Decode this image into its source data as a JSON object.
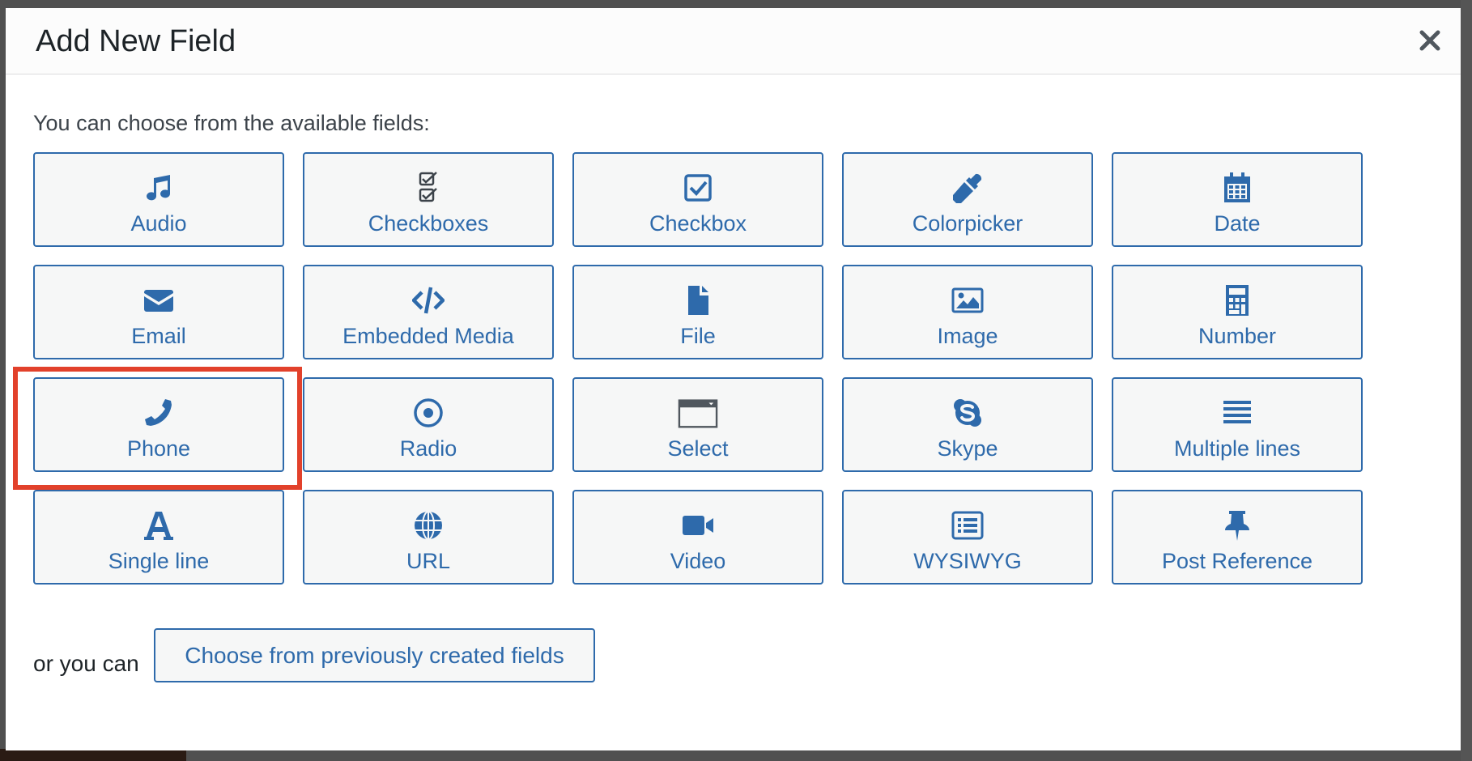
{
  "modal": {
    "title": "Add New Field",
    "close_icon": "close-icon",
    "intro": "You can choose from the available fields:",
    "footer_prefix": "or you can",
    "previous_button": "Choose from previously created fields"
  },
  "fields": [
    {
      "label": "Audio",
      "icon": "music-icon"
    },
    {
      "label": "Checkboxes",
      "icon": "checkboxes-icon"
    },
    {
      "label": "Checkbox",
      "icon": "checkbox-icon"
    },
    {
      "label": "Colorpicker",
      "icon": "eyedropper-icon"
    },
    {
      "label": "Date",
      "icon": "calendar-icon"
    },
    {
      "label": "Email",
      "icon": "envelope-icon"
    },
    {
      "label": "Embedded Media",
      "icon": "code-icon"
    },
    {
      "label": "File",
      "icon": "file-icon"
    },
    {
      "label": "Image",
      "icon": "image-icon"
    },
    {
      "label": "Number",
      "icon": "calculator-icon"
    },
    {
      "label": "Phone",
      "icon": "phone-icon"
    },
    {
      "label": "Radio",
      "icon": "radio-icon"
    },
    {
      "label": "Select",
      "icon": "select-icon"
    },
    {
      "label": "Skype",
      "icon": "skype-icon"
    },
    {
      "label": "Multiple lines",
      "icon": "lines-icon"
    },
    {
      "label": "Single line",
      "icon": "font-icon"
    },
    {
      "label": "URL",
      "icon": "globe-icon"
    },
    {
      "label": "Video",
      "icon": "video-icon"
    },
    {
      "label": "WYSIWYG",
      "icon": "list-alt-icon"
    },
    {
      "label": "Post Reference",
      "icon": "pin-icon"
    }
  ],
  "colors": {
    "accent": "#2e6aab",
    "highlight": "#e2412b"
  }
}
